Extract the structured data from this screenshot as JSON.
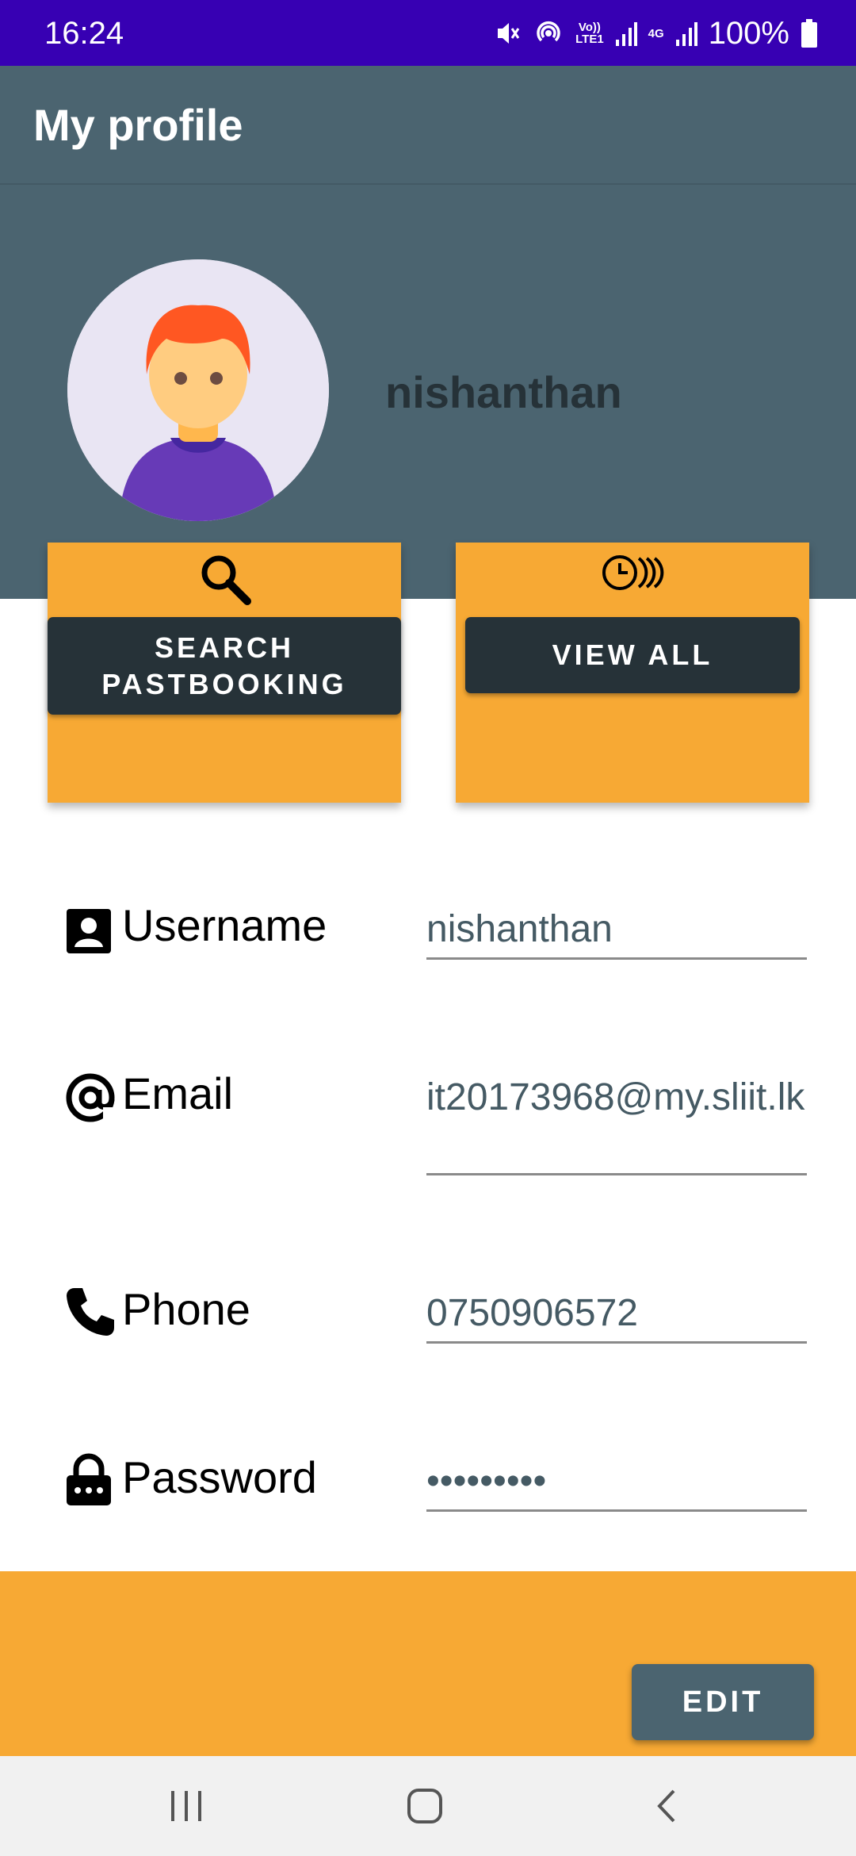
{
  "status_bar": {
    "time": "16:24",
    "volte_label_top": "Vo))",
    "volte_label_bottom": "LTE1",
    "network_label": "4G",
    "battery_percent": "100%",
    "icons": [
      "mute-icon",
      "hotspot-icon",
      "volte-icon",
      "signal-icon",
      "4g-icon",
      "signal-icon",
      "battery-icon"
    ]
  },
  "app_bar": {
    "title": "My profile"
  },
  "profile": {
    "name": "nishanthan"
  },
  "actions": {
    "search_button": "SEARCH PASTBOOKING",
    "view_all_button": "VIEW ALL"
  },
  "fields": {
    "username": {
      "label": "Username",
      "value": "nishanthan"
    },
    "email": {
      "label": "Email",
      "value": "it20173968@my.sliit.lk"
    },
    "phone": {
      "label": "Phone",
      "value": "0750906572"
    },
    "password": {
      "label": "Password",
      "value": "•••••••••"
    }
  },
  "footer": {
    "edit_button": "EDIT"
  },
  "colors": {
    "status_bar": "#3700b3",
    "primary": "#4b6470",
    "accent": "#f7a934",
    "dark_button": "#263238"
  }
}
